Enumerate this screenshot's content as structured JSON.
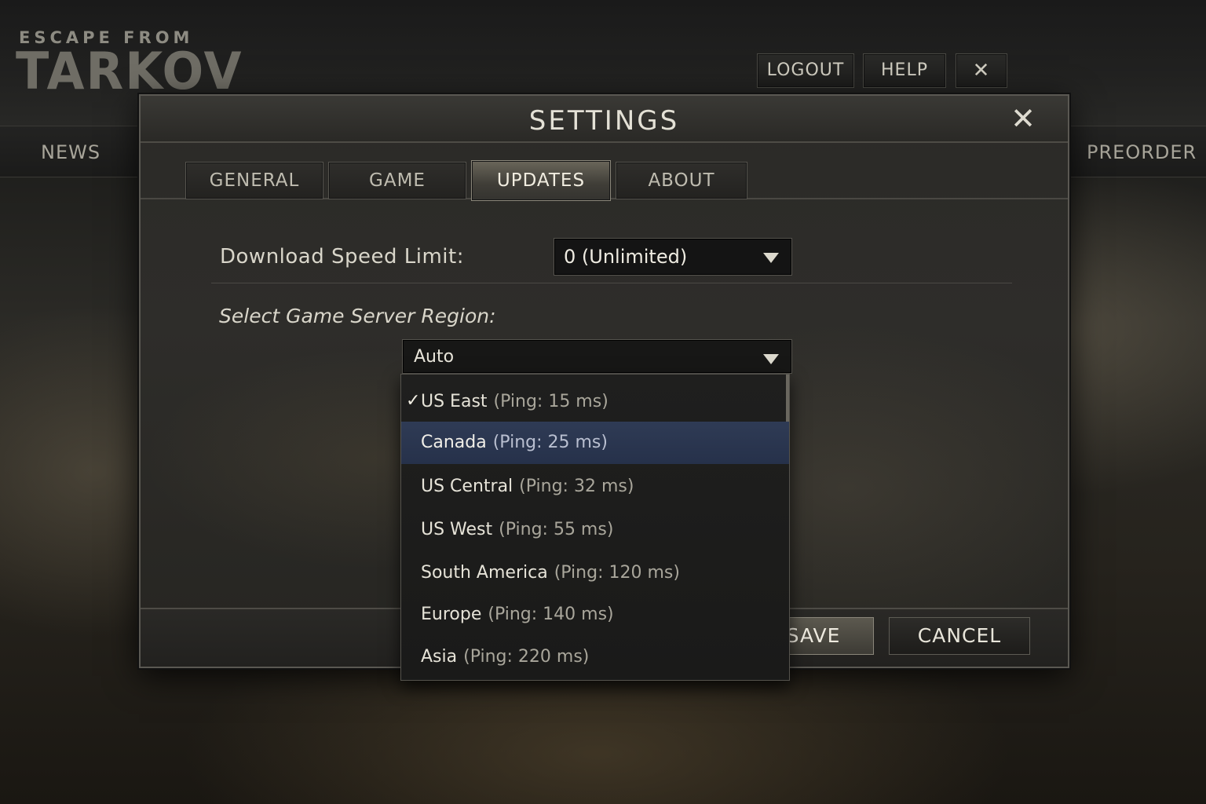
{
  "app": {
    "logo_top": "ESCAPE FROM",
    "logo_main": "TARKOV"
  },
  "top_buttons": {
    "logout": "LOGOUT",
    "help": "HELP",
    "close": "✕"
  },
  "nav": {
    "news": "NEWS",
    "preorder": "PREORDER"
  },
  "dialog": {
    "title": "SETTINGS",
    "close": "✕",
    "tabs": [
      {
        "label": "GENERAL",
        "active": false
      },
      {
        "label": "GAME",
        "active": false
      },
      {
        "label": "UPDATES",
        "active": true
      },
      {
        "label": "ABOUT",
        "active": false
      }
    ],
    "download_speed": {
      "label": "Download Speed Limit:",
      "value": "0 (Unlimited)"
    },
    "server_region": {
      "label": "Select Game Server Region:",
      "value": "Auto",
      "options": [
        {
          "name": "US East",
          "ping": "(Ping: 15 ms)",
          "checked": true,
          "highlighted": false
        },
        {
          "name": "Canada",
          "ping": "(Ping: 25 ms)",
          "checked": false,
          "highlighted": true
        },
        {
          "name": "US Central",
          "ping": "(Ping: 32 ms)",
          "checked": false,
          "highlighted": false
        },
        {
          "name": "US West",
          "ping": "(Ping: 55 ms)",
          "checked": false,
          "highlighted": false
        },
        {
          "name": "South America",
          "ping": "(Ping: 120 ms)",
          "checked": false,
          "highlighted": false
        },
        {
          "name": "Europe",
          "ping": "(Ping: 140 ms)",
          "checked": false,
          "highlighted": false
        },
        {
          "name": "Asia",
          "ping": "(Ping: 220 ms)",
          "checked": false,
          "highlighted": false
        }
      ],
      "check_glyph": "✓"
    },
    "footer": {
      "save": "SAVE",
      "cancel": "CANCEL"
    }
  },
  "colors": {
    "highlight": "#2b3650",
    "accent_tab": "#6a665a"
  }
}
